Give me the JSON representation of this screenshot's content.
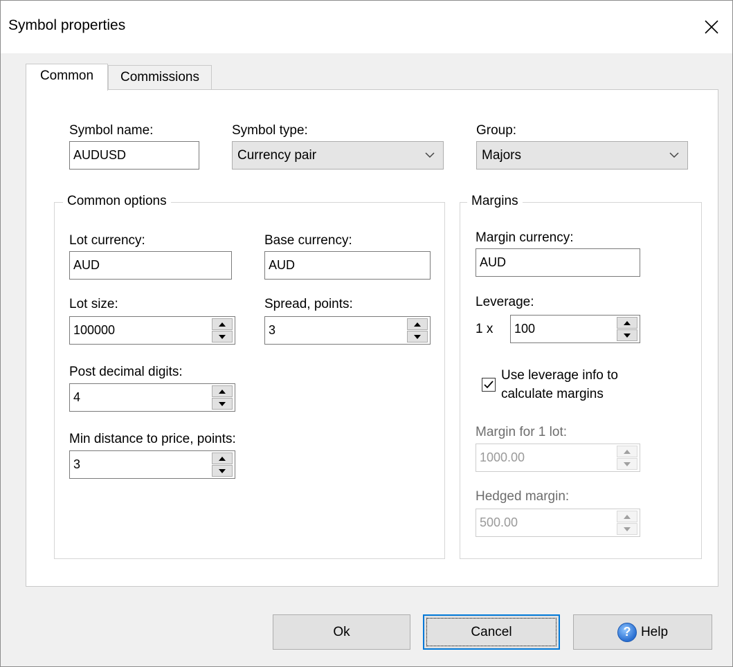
{
  "window": {
    "title": "Symbol properties"
  },
  "tabs": [
    {
      "label": "Common",
      "active": true
    },
    {
      "label": "Commissions",
      "active": false
    }
  ],
  "common": {
    "symbol_name_label": "Symbol name:",
    "symbol_name_value": "AUDUSD",
    "symbol_type_label": "Symbol type:",
    "symbol_type_value": "Currency pair",
    "group_label": "Group:",
    "group_value": "Majors",
    "common_options_legend": "Common options",
    "lot_currency_label": "Lot currency:",
    "lot_currency_value": "AUD",
    "base_currency_label": "Base currency:",
    "base_currency_value": "AUD",
    "lot_size_label": "Lot size:",
    "lot_size_value": "100000",
    "spread_label": "Spread, points:",
    "spread_value": "3",
    "post_decimal_label": "Post decimal digits:",
    "post_decimal_value": "4",
    "min_distance_label": "Min distance to price, points:",
    "min_distance_value": "3"
  },
  "margins": {
    "legend": "Margins",
    "margin_currency_label": "Margin currency:",
    "margin_currency_value": "AUD",
    "leverage_label": "Leverage:",
    "leverage_prefix": "1 x",
    "leverage_value": "100",
    "use_leverage_line1": "Use leverage info to",
    "use_leverage_line2": "calculate margins",
    "use_leverage_checked": true,
    "margin_per_lot_label": "Margin for 1 lot:",
    "margin_per_lot_value": "1000.00",
    "hedged_margin_label": "Hedged margin:",
    "hedged_margin_value": "500.00"
  },
  "buttons": {
    "ok": "Ok",
    "cancel": "Cancel",
    "help": "Help"
  },
  "colors": {
    "accent_focus": "#0078d7",
    "disabled_text": "#9a9a9a"
  }
}
